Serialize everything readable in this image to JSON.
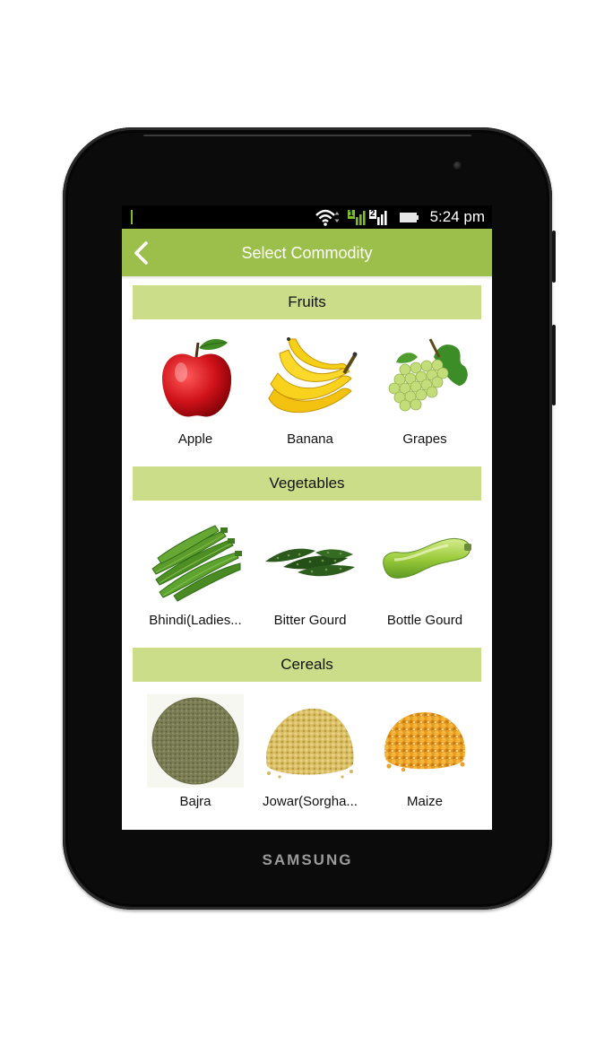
{
  "device": {
    "brand": "SAMSUNG"
  },
  "status_bar": {
    "time": "5:24 pm",
    "sim_1": "1",
    "sim_2": "2"
  },
  "app_bar": {
    "title": "Select Commodity",
    "back_icon": "chevron-left-icon"
  },
  "colors": {
    "app_bar": "#9cbe4a",
    "section_header": "#cbdd88",
    "status_bar": "#000000"
  },
  "sections": [
    {
      "title": "Fruits",
      "items": [
        {
          "label": "Apple"
        },
        {
          "label": "Banana"
        },
        {
          "label": "Grapes"
        }
      ]
    },
    {
      "title": "Vegetables",
      "items": [
        {
          "label": "Bhindi(Ladies..."
        },
        {
          "label": "Bitter Gourd"
        },
        {
          "label": "Bottle Gourd"
        }
      ]
    },
    {
      "title": "Cereals",
      "items": [
        {
          "label": "Bajra"
        },
        {
          "label": "Jowar(Sorgha..."
        },
        {
          "label": "Maize"
        }
      ]
    }
  ]
}
